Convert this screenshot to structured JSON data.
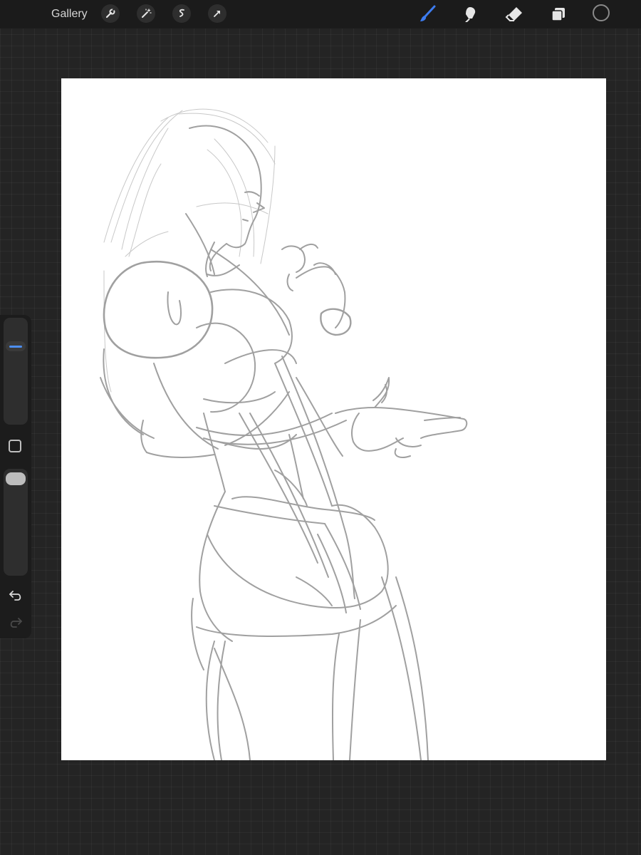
{
  "topbar": {
    "gallery_label": "Gallery",
    "left_tools": [
      "wrench-icon",
      "magic-wand-icon",
      "selection-icon",
      "transform-arrow-icon"
    ],
    "right_tools": [
      "brush-icon",
      "smudge-icon",
      "eraser-icon",
      "layers-icon"
    ],
    "active_tool": "brush-icon",
    "accent_color": "#3d7cf0",
    "current_color": "#1b1b1b"
  },
  "sidebar": {
    "brush_size_level": 0.24,
    "opacity_level": 0.04,
    "undo_icon": "undo-icon",
    "redo_icon": "redo-icon",
    "modify_icon": "square-modify-icon"
  },
  "canvas": {
    "background": "#ffffff",
    "sketch_color": "#9a9a9a"
  }
}
